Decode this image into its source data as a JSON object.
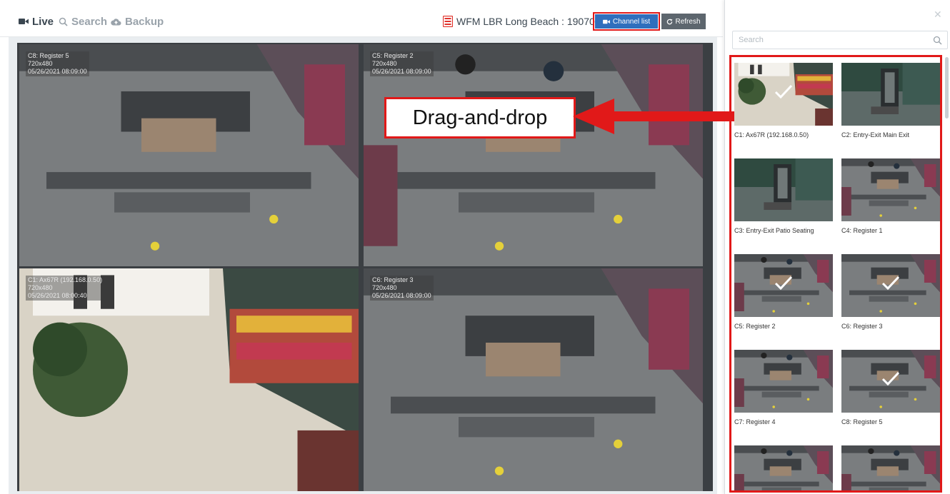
{
  "tabs": [
    {
      "label": "Live",
      "icon": "video-camera-icon",
      "active": true
    },
    {
      "label": "Search",
      "icon": "search-icon",
      "active": false
    },
    {
      "label": "Backup",
      "icon": "cloud-upload-icon",
      "active": false
    }
  ],
  "header": {
    "site_title": "WFM LBR Long Beach : 1907076",
    "site_icon": "recorder-icon",
    "channel_list_label": "Channel list",
    "refresh_label": "Refresh"
  },
  "tiles": [
    {
      "name": "C8: Register 5",
      "resolution": "720x480",
      "timestamp": "05/26/2021 08:09:00"
    },
    {
      "name": "C5: Register 2",
      "resolution": "720x480",
      "timestamp": "05/26/2021 08:09:00"
    },
    {
      "name": "C1: Ax67R (192.168.0.50)",
      "resolution": "720x480",
      "timestamp": "05/26/2021 08:00:40"
    },
    {
      "name": "C6: Register 3",
      "resolution": "720x480",
      "timestamp": "05/26/2021 08:09:00"
    }
  ],
  "annotation": {
    "label": "Drag-and-drop",
    "color": "#e11919"
  },
  "panel": {
    "search_placeholder": "Search",
    "channels": [
      {
        "label": "C1: Ax67R (192.168.0.50)",
        "checked": true
      },
      {
        "label": "C2: Entry-Exit Main Exit",
        "checked": false
      },
      {
        "label": "C3: Entry-Exit Patio Seating",
        "checked": false
      },
      {
        "label": "C4: Register 1",
        "checked": false
      },
      {
        "label": "C5: Register 2",
        "checked": true
      },
      {
        "label": "C6: Register 3",
        "checked": true
      },
      {
        "label": "C7: Register 4",
        "checked": false
      },
      {
        "label": "C8: Register 5",
        "checked": true
      },
      {
        "label": "",
        "checked": false
      },
      {
        "label": "",
        "checked": false
      }
    ]
  },
  "colors": {
    "accent": "#2f6fbd",
    "highlight": "#e11919",
    "refresh": "#5d666e"
  }
}
